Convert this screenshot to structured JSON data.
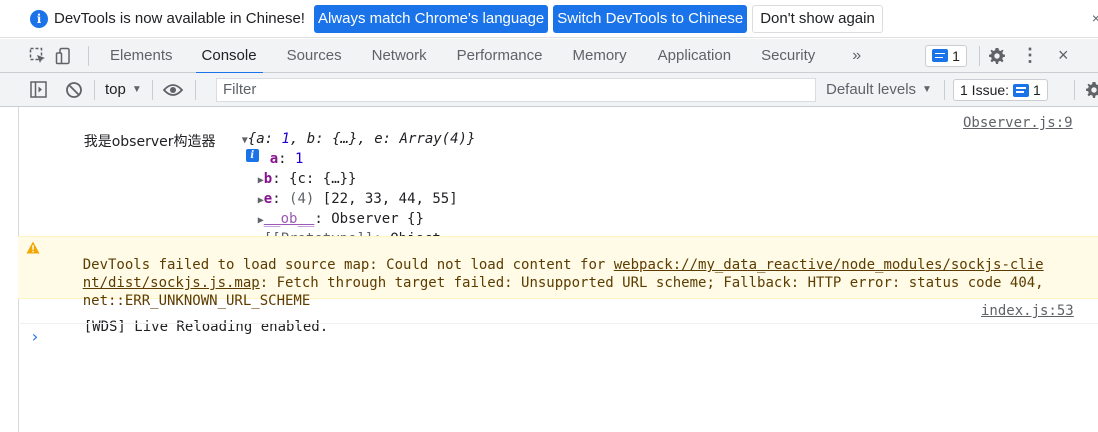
{
  "infobar": {
    "icon": "info-icon",
    "message": "DevTools is now available in Chinese!",
    "btn_match": "Always match Chrome's language",
    "btn_switch": "Switch DevTools to Chinese",
    "btn_dismiss": "Don't show again",
    "close": "×",
    "accent": "#1a73e8"
  },
  "tabs": {
    "items": [
      "Elements",
      "Console",
      "Sources",
      "Network",
      "Performance",
      "Memory",
      "Application",
      "Security"
    ],
    "active": "Console",
    "more": "»",
    "message_count": "1",
    "kebab": "⋮",
    "close": "×"
  },
  "console_toolbar": {
    "context": "top",
    "context_arrow": "▼",
    "filter_placeholder": "Filter",
    "levels": "Default levels",
    "levels_arrow": "▼",
    "issues_label": "1 Issue:",
    "issues_count": "1"
  },
  "console": {
    "log1": {
      "label": "我是observer构造器",
      "summary_open": "{",
      "summary_a_key": "a",
      "summary_a_val": "1",
      "summary_b_key": "b",
      "summary_b_val": "{…}",
      "summary_e_key": "e",
      "summary_e_val": "Array(4)",
      "summary_close": "}",
      "source": "Observer.js:9",
      "props": {
        "a_key": "a",
        "a_val": "1",
        "b_key": "b",
        "b_val": "{c: {…}}",
        "e_key": "e",
        "e_count": "(4)",
        "e_val": "[22, 33, 44, 55]",
        "ob_key": "__ob__",
        "ob_val": "Observer {}",
        "proto_key": "[[Prototype]]",
        "proto_val": "Object"
      }
    },
    "warning": {
      "line1_text": "DevTools failed to load source map: Could not load content for ",
      "line1_link": "webpack://my_data_reactive/node_modules/sockjs-clie",
      "line2_link": "nt/dist/sockjs.js.map",
      "line2_text": ": Fetch through target failed: Unsupported URL scheme; Fallback: HTTP error: status code 404,",
      "line3_text": "net::ERR_UNKNOWN_URL_SCHEME",
      "color_bg": "#fffbe6"
    },
    "log2": {
      "text": "[WDS] Live Reloading enabled.",
      "source": "index.js:53"
    },
    "prompt": "›"
  }
}
